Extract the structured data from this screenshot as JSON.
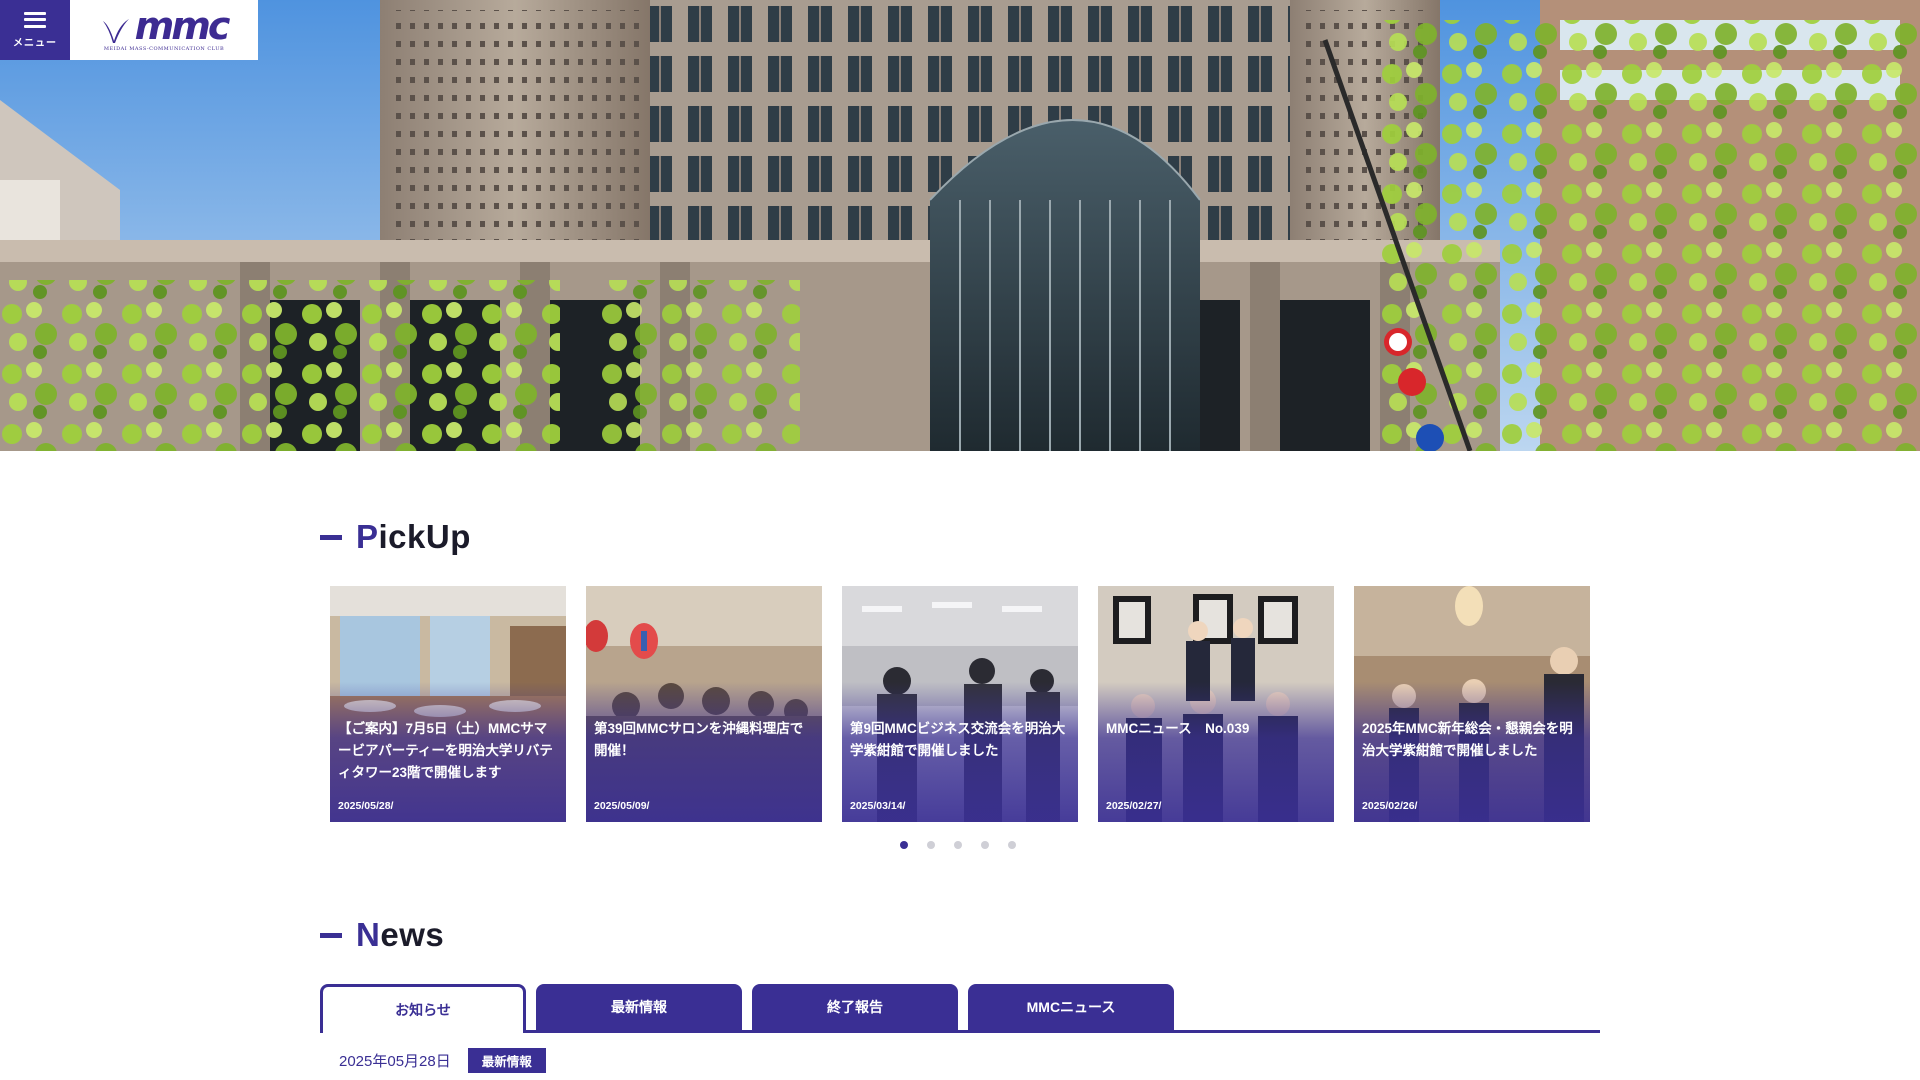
{
  "header": {
    "menu_label": "メニュー",
    "logo_text": "mmc",
    "logo_subtext": "MEIDAI MASS-COMMUNICATION CLUB"
  },
  "pickup": {
    "title_first": "P",
    "title_rest": "ickUp",
    "cards": [
      {
        "title": "【ご案内】7月5日（土）MMCサマービアパーティーを明治大学リバティタワー23階で開催します",
        "date": "2025/05/28/"
      },
      {
        "title": "第39回MMCサロンを沖縄料理店で開催！",
        "date": "2025/05/09/"
      },
      {
        "title": "第9回MMCビジネス交流会を明治大学紫紺館で開催しました",
        "date": "2025/03/14/"
      },
      {
        "title": "MMCニュース　No.039",
        "date": "2025/02/27/"
      },
      {
        "title": "2025年MMC新年総会・懇親会を明治大学紫紺館で開催しました",
        "date": "2025/02/26/"
      }
    ],
    "dots_total": 5,
    "dots_active": 1
  },
  "news": {
    "title_first": "N",
    "title_rest": "ews",
    "tabs": [
      {
        "label": "お知らせ",
        "active": true
      },
      {
        "label": "最新情報",
        "active": false
      },
      {
        "label": "終了報告",
        "active": false
      },
      {
        "label": "MMCニュース",
        "active": false
      }
    ],
    "items": [
      {
        "date": "2025年05月28日",
        "category": "最新情報"
      }
    ]
  },
  "colors": {
    "brand": "#3a2f94",
    "inactive_dot": "#cfcfd6"
  },
  "icons": {
    "menu": "hamburger-icon",
    "logo_mark": "v-wing-logo-icon"
  }
}
